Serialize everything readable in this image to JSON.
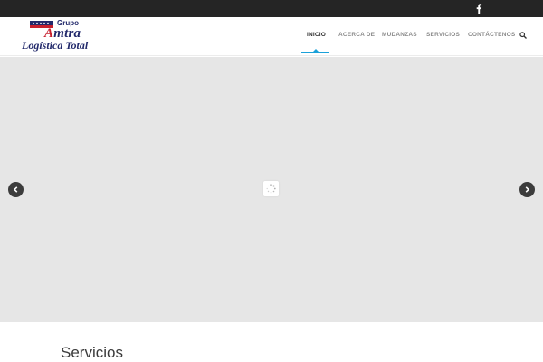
{
  "logo": {
    "grupo": "Grupo",
    "brand_prefix": "A",
    "brand_rest": "mtra",
    "subtitle": "Logística Total",
    "colors": {
      "navy": "#22296b",
      "red": "#c7202e"
    }
  },
  "social": {
    "icon": "facebook-icon"
  },
  "nav": {
    "items": [
      "INICIO",
      "ACERCA DE",
      "MUDANZAS",
      "SERVICIOS",
      "CONTÁCTENOS"
    ],
    "active_index": 0,
    "accent_color": "#1ba1d9"
  },
  "slider": {
    "background": "#e6e6e6",
    "prev_icon": "chevron-left-icon",
    "next_icon": "chevron-right-icon",
    "loader_icon": "spinner-icon"
  },
  "section": {
    "title": "Servicios"
  }
}
